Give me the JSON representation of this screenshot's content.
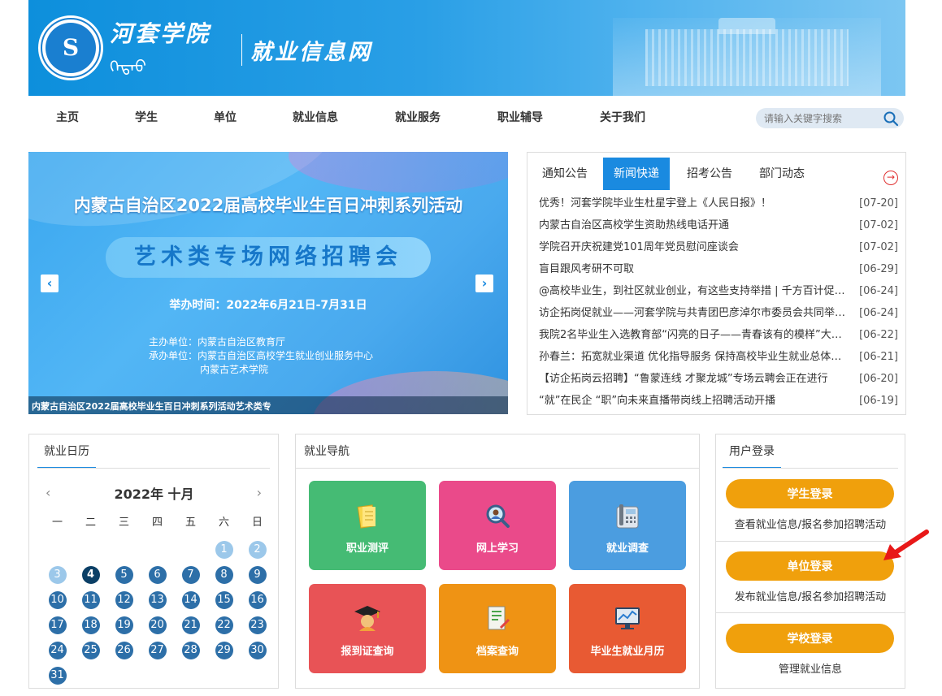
{
  "header": {
    "college_cn": "河套学院",
    "college_mn": "ᠬᠡᠲᠠᠣ",
    "site_name": "就业信息网",
    "logo_text": "S"
  },
  "nav": {
    "items": [
      "主页",
      "学生",
      "单位",
      "就业信息",
      "就业服务",
      "职业辅导",
      "关于我们"
    ],
    "search_placeholder": "请输入关键字搜索"
  },
  "slider": {
    "title": "内蒙古自治区2022届高校毕业生百日冲刺系列活动",
    "subtitle": "艺术类专场网络招聘会",
    "time": "举办时间：2022年6月21日-7月31日",
    "host": "主办单位：内蒙古自治区教育厅",
    "organizer": "承办单位：内蒙古自治区高校学生就业创业服务中心",
    "organizer2": "内蒙古艺术学院",
    "caption": "内蒙古自治区2022届高校毕业生百日冲刺系列活动艺术类专",
    "prev": "‹",
    "next": "›",
    "dot_count": 6,
    "active_dot": 6
  },
  "news": {
    "tabs": [
      "通知公告",
      "新闻快递",
      "招考公告",
      "部门动态"
    ],
    "active_tab": 1,
    "more": "→",
    "items": [
      {
        "title": "优秀！河套学院毕业生杜星宇登上《人民日报》！",
        "date": "[07-20]"
      },
      {
        "title": "内蒙古自治区高校学生资助热线电话开通",
        "date": "[07-02]"
      },
      {
        "title": "学院召开庆祝建党101周年党员慰问座谈会",
        "date": "[07-02]"
      },
      {
        "title": "盲目跟风考研不可取",
        "date": "[06-29]"
      },
      {
        "title": "@高校毕业生，到社区就业创业，有这些支持举措 | 千方百计促就业",
        "date": "[06-24]"
      },
      {
        "title": "访企拓岗促就业——河套学院与共青团巴彦淖尔市委员会共同举办…",
        "date": "[06-24]"
      },
      {
        "title": "我院2名毕业生入选教育部“闪亮的日子——青春该有的模样”大…",
        "date": "[06-22]"
      },
      {
        "title": "孙春兰：拓宽就业渠道 优化指导服务 保持高校毕业生就业总体稳定",
        "date": "[06-21]"
      },
      {
        "title": "【访企拓岗云招聘】“鲁蒙连线 才聚龙城”专场云聘会正在进行",
        "date": "[06-20]"
      },
      {
        "title": "“就”在民企 “职”向未来直播带岗线上招聘活动开播",
        "date": "[06-19]"
      }
    ]
  },
  "calendar": {
    "title": "就业日历",
    "month": "2022年 十月",
    "prev": "‹",
    "next": "›",
    "weekdays": [
      "一",
      "二",
      "三",
      "四",
      "五",
      "六",
      "日"
    ],
    "lead_blanks": 5,
    "days": 31,
    "light_days": [
      1,
      2,
      3
    ],
    "today": 4
  },
  "guide": {
    "title": "就业导航",
    "tiles": [
      {
        "label": "职业测评",
        "color": "#45bb74",
        "icon": "note-icon"
      },
      {
        "label": "网上学习",
        "color": "#ea4a8a",
        "icon": "magnifier-icon"
      },
      {
        "label": "就业调查",
        "color": "#4b9de0",
        "icon": "phone-icon"
      },
      {
        "label": "报到证查询",
        "color": "#e85356",
        "icon": "graduate-icon"
      },
      {
        "label": "档案查询",
        "color": "#ef9314",
        "icon": "file-icon"
      },
      {
        "label": "毕业生就业月历",
        "color": "#e85a33",
        "icon": "monitor-icon"
      }
    ]
  },
  "login": {
    "title": "用户登录",
    "student_btn": "学生登录",
    "student_desc": "查看就业信息/报名参加招聘活动",
    "company_btn": "单位登录",
    "company_desc": "发布就业信息/报名参加招聘活动",
    "school_btn": "学校登录",
    "school_desc": "管理就业信息"
  },
  "colors": {
    "accent": "#1a8ae0",
    "login_button": "#f0a00c",
    "calendar_day": "#2d6fa8"
  }
}
